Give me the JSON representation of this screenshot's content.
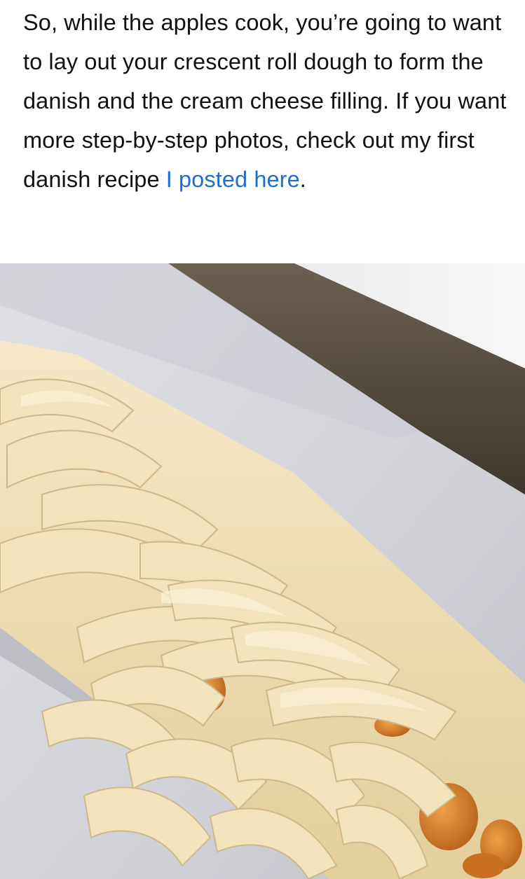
{
  "article": {
    "paragraph_text": "So, while the apples cook, you’re going to want to lay out your crescent roll dough to form the danish and the cream cheese filling. If you want more step-by-step photos, check out my first danish recipe ",
    "link_text": "I posted here",
    "trailing_text": "."
  },
  "photo": {
    "subject": "braided crescent roll apple danish on parchment-lined baking sheet",
    "colors": {
      "parchment": "#d8d9de",
      "pan_rim": "#5a5044",
      "dough": "#efe1b8",
      "dough_shadow": "#cdb98a",
      "apple_filling": "#d9842e"
    }
  }
}
